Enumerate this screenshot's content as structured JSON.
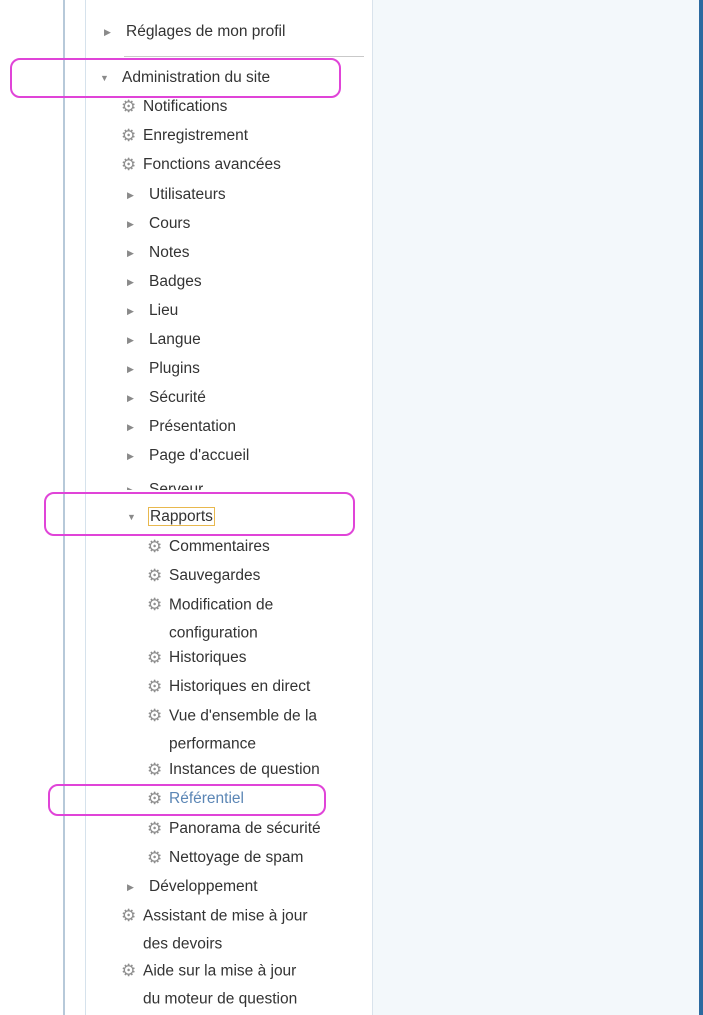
{
  "nav": {
    "profile_settings": "Réglages de mon profil",
    "site_admin": "Administration du site",
    "notifications": "Notifications",
    "registration": "Enregistrement",
    "advanced_features": "Fonctions avancées",
    "users": "Utilisateurs",
    "courses": "Cours",
    "grades": "Notes",
    "badges": "Badges",
    "location": "Lieu",
    "language": "Langue",
    "plugins": "Plugins",
    "security": "Sécurité",
    "appearance": "Présentation",
    "front_page": "Page d'accueil",
    "server": "Serveur",
    "reports": "Rapports",
    "reports_items": {
      "comments": "Commentaires",
      "backups": "Sauvegardes",
      "config_changes_1": "Modification de",
      "config_changes_2": "configuration",
      "logs": "Historiques",
      "live_logs": "Historiques en direct",
      "performance_1": "Vue d'ensemble de la",
      "performance_2": "performance",
      "question_instances": "Instances de question",
      "competency": "Référentiel",
      "security_overview": "Panorama de sécurité",
      "spam_cleaner": "Nettoyage de spam"
    },
    "development": "Développement",
    "assignment_upgrade_1": "Assistant de mise à jour",
    "assignment_upgrade_2": "des devoirs",
    "question_engine_help_1": "Aide sur la mise à jour",
    "question_engine_help_2": "du moteur de question"
  },
  "icons": {
    "collapsed": "triangle-right-icon",
    "expanded": "triangle-down-icon",
    "settings": "gear-icon"
  },
  "colors": {
    "highlight": "#e044d8",
    "link": "#5b86b5",
    "focus_box": "#e8b84e"
  }
}
